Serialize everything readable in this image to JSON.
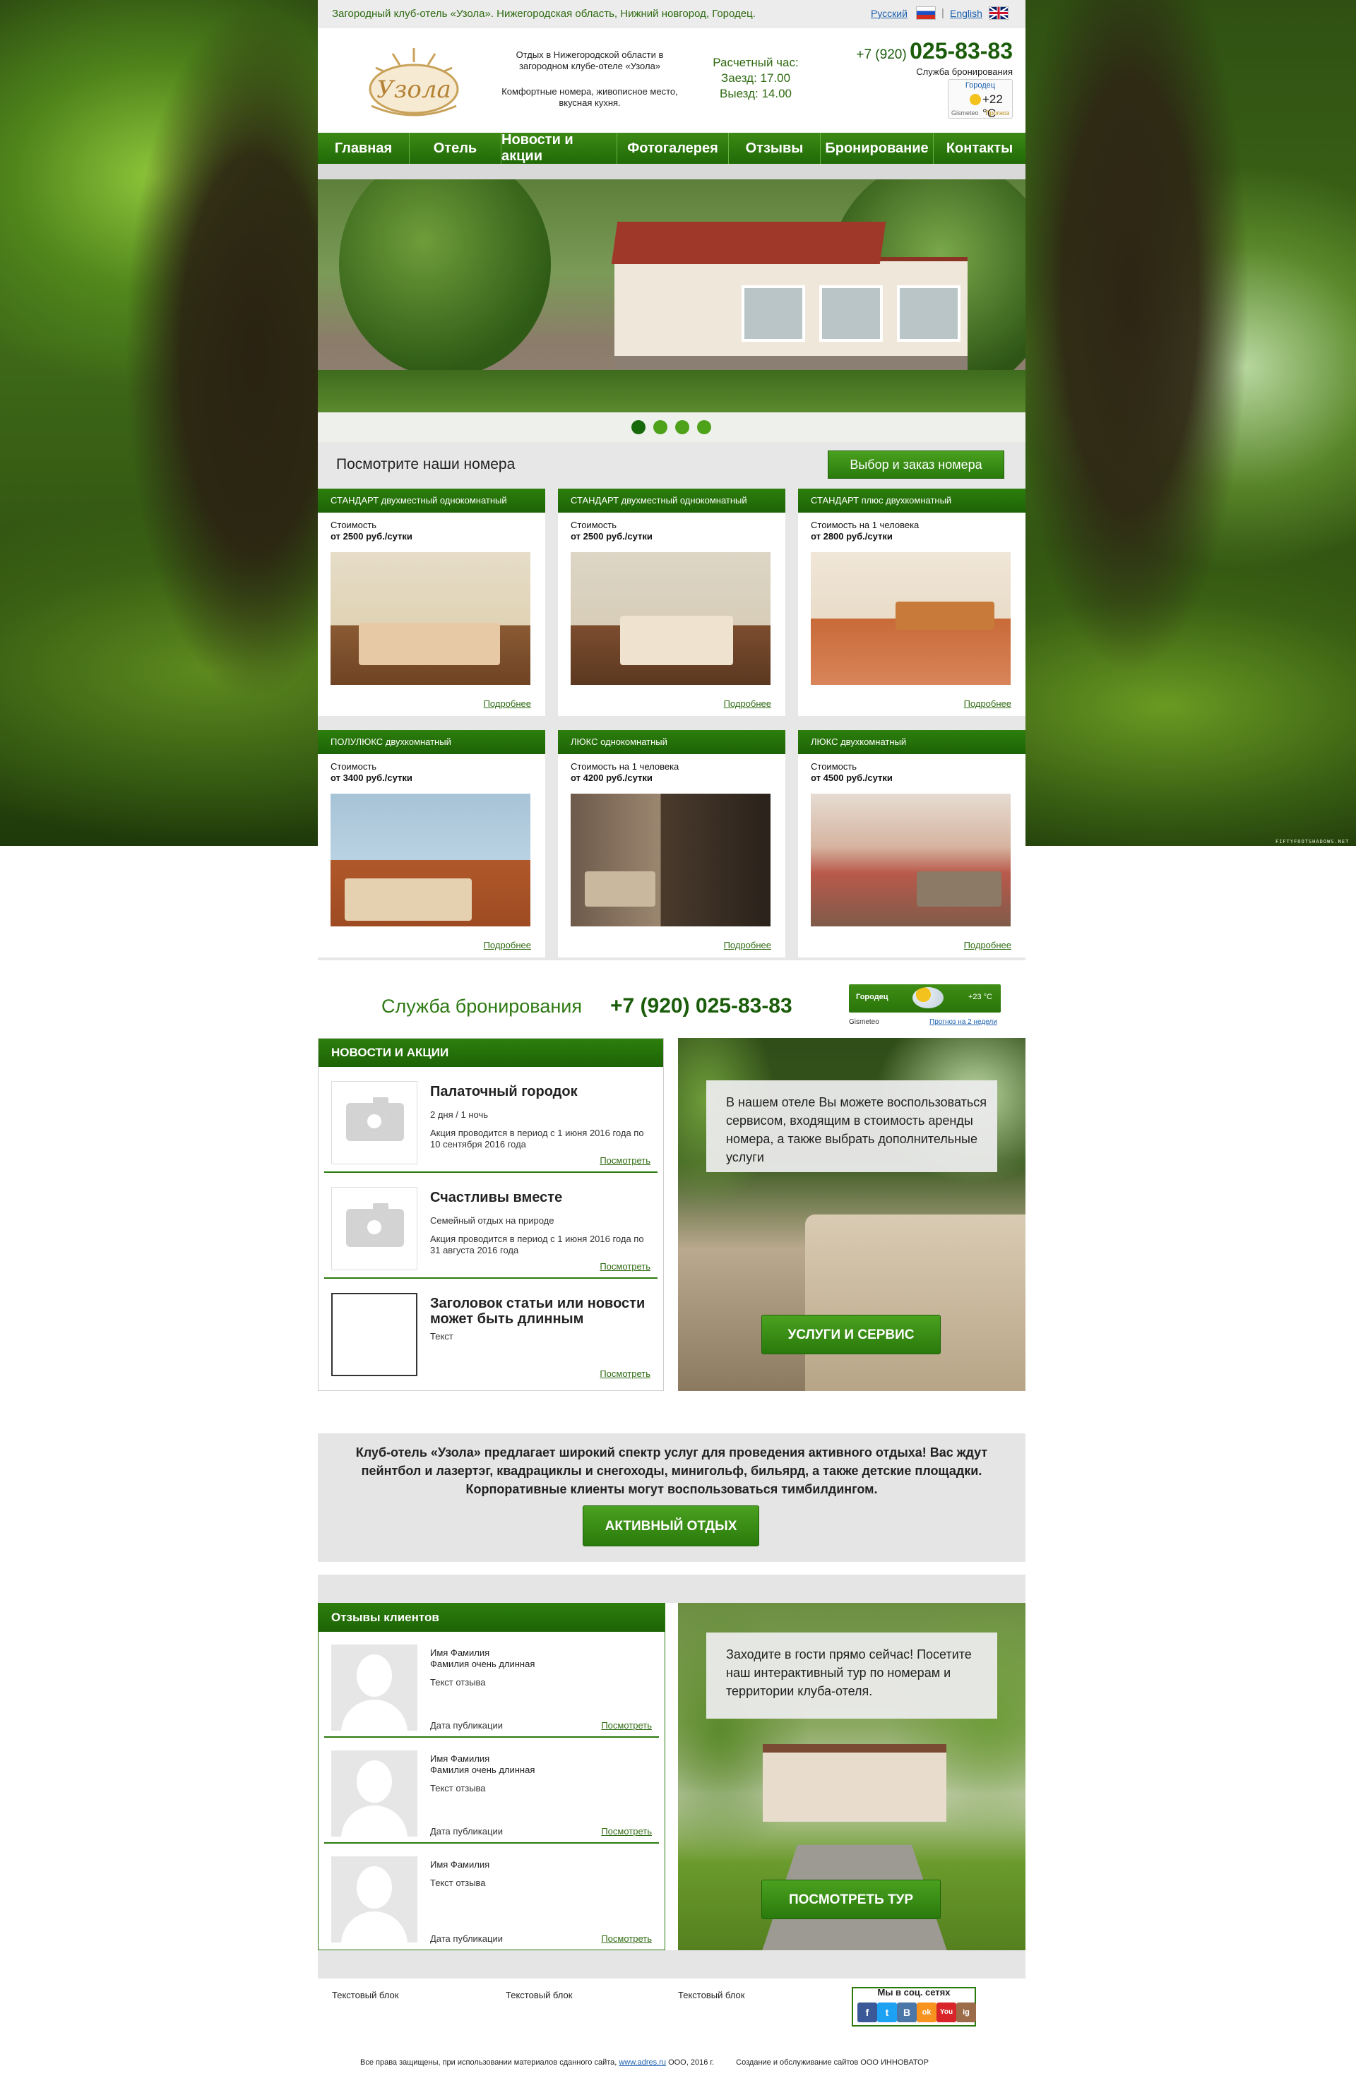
{
  "topbar": {
    "tagline": "Загородный клуб-отель «Узола». Нижегородская область, Нижний новгород, Городец.",
    "lang_ru": "Русский",
    "lang_en": "English"
  },
  "header": {
    "logo_text": "Узола",
    "desc1": "Отдых в Нижегородской области в загородном клубе-отеле «Узола»",
    "desc2": "Комфортные номера, живописное место, вкусная кухня.",
    "checkin_title": "Расчетный час:",
    "checkin_in": "Заезд: 17.00",
    "checkin_out": "Выезд: 14.00",
    "phone_code": "+7 (920)",
    "phone_number": "025-83-83",
    "booking_label": "Служба бронирования",
    "weather": {
      "city": "Городец",
      "temp": "+22 °C",
      "brand": "Gismeteo",
      "forecast": "Прогноз"
    }
  },
  "nav": {
    "items": [
      "Главная",
      "Отель",
      "Новости и акции",
      "Фотогалерея",
      "Отзывы",
      "Бронирование",
      "Контакты"
    ]
  },
  "slider": {
    "dots": 4,
    "active": 0
  },
  "rooms": {
    "title": "Посмотрите наши номера",
    "cta": "Выбор и заказ номера",
    "more_label": "Подробнее",
    "cards": [
      {
        "title": "СТАНДАРТ двухместный однокомнатный",
        "price_line1": "Стоимость",
        "price_line2": "от 2500 руб./сутки"
      },
      {
        "title": "СТАНДАРТ двухместный однокомнатный",
        "price_line1": "Стоимость",
        "price_line2": "от 2500 руб./сутки"
      },
      {
        "title": "СТАНДАРТ плюс двухкомнатный",
        "price_line1": "Стоимость на 1 человека",
        "price_line2": "от 2800 руб./сутки"
      },
      {
        "title": "ПОЛУЛЮКС двухкомнатный",
        "price_line1": "Стоимость",
        "price_line2": "от 3400 руб./сутки"
      },
      {
        "title": "ЛЮКС однокомнатный",
        "price_line1": "Стоимость на 1 человека",
        "price_line2": "от 4200 руб./сутки"
      },
      {
        "title": "ЛЮКС двухкомнатный",
        "price_line1": "Стоимость",
        "price_line2": "от 4500 руб./сутки"
      }
    ]
  },
  "booking": {
    "label": "Служба бронирования",
    "phone": "+7 (920) 025-83-83",
    "weather": {
      "city": "Городец",
      "temp": "+23 °C",
      "brand": "Gismeteo",
      "forecast": "Прогноз на 2 недели"
    }
  },
  "news": {
    "title": "НОВОСТИ И АКЦИИ",
    "more_label": "Посмотреть",
    "items": [
      {
        "title": "Палаточный городок",
        "sub": "2 дня / 1 ночь",
        "text": "Акция проводится в период с 1 июня 2016 года по 10 сентября 2016 года"
      },
      {
        "title": "Счастливы вместе",
        "sub": "Семейный отдых на природе",
        "text": "Акция проводится в период с 1 июня 2016 года по 31 августа 2016 года"
      },
      {
        "title": "Заголовок статьи или новости может быть длинным",
        "sub": "Текст",
        "text": ""
      }
    ]
  },
  "services": {
    "text": "В нашем отеле Вы можете воспользоваться сервисом, входящим в стоимость аренды номера, а также выбрать дополнительные услуги",
    "button": "УСЛУГИ И СЕРВИС"
  },
  "active": {
    "text": "Клуб-отель «Узола» предлагает широкий спектр услуг для проведения активного отдыха! Вас ждут пейнтбол и лазертэг, квадрациклы и снегоходы, минигольф, бильярд, а также детские площадки. Корпоративные клиенты могут воспользоваться тимбилдингом.",
    "button": "АКТИВНЫЙ ОТДЫХ"
  },
  "reviews": {
    "title": "Отзывы клиентов",
    "more_label": "Посмотреть",
    "items": [
      {
        "name1": "Имя Фамилия",
        "name2": "Фамилия очень длинная",
        "text": "Текст отзыва",
        "date": "Дата публикации"
      },
      {
        "name1": "Имя Фамилия",
        "name2": "Фамилия очень длинная",
        "text": "Текст отзыва",
        "date": "Дата публикации"
      },
      {
        "name1": "Имя Фамилия",
        "name2": "",
        "text": "Текст отзыва",
        "date": "Дата публикации"
      }
    ]
  },
  "tour": {
    "text": "Заходите в гости прямо сейчас! Посетите наш интерактивный тур по номерам и территории клуба-отеля.",
    "button": "ПОСМОТРЕТЬ ТУР"
  },
  "footer": {
    "blocks": [
      "Текстовый блок",
      "Текстовый блок",
      "Текстовый блок"
    ],
    "social_title": "Мы в соц. сетях",
    "social": [
      "f",
      "t",
      "B",
      "ok",
      "You",
      "ig"
    ],
    "copyright_pre": "Все права защищены, при использовании материалов сданного сайта,",
    "copyright_site": "www.adres.ru",
    "copyright_post": "ООО, 2016 г.",
    "developer": "Создание и обслуживание сайтов ООО ИННОВАТОР"
  },
  "background_credit": "FIFTYFOOTSHADOWS.NET",
  "colors": {
    "brand_green": "#2a7a0c",
    "nav_top": "#3c8a15",
    "nav_bottom": "#206a07"
  }
}
